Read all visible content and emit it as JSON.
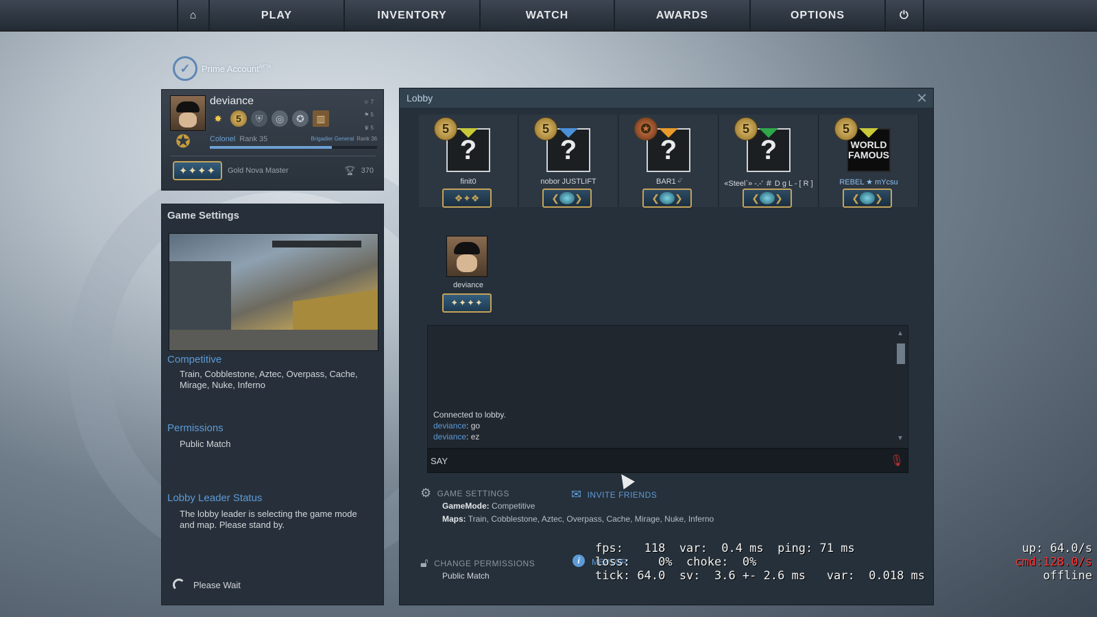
{
  "nav": {
    "items": [
      "PLAY",
      "INVENTORY",
      "WATCH",
      "AWARDS",
      "OPTIONS"
    ],
    "home_icon": "home-icon",
    "power_icon": "power-icon"
  },
  "prime": {
    "label": "Prime Account",
    "beta": "BETA"
  },
  "profile": {
    "name": "deviance",
    "stats": [
      "7",
      "5",
      "5"
    ],
    "rank_name": "Colonel",
    "rank_label": "Rank 35",
    "next_rank_name": "Brigadier General",
    "next_rank_label": "Rank 36",
    "xp_fraction": 0.73,
    "skill_group": "Gold Nova Master",
    "trophy_count": "370"
  },
  "game_settings": {
    "title": "Game Settings",
    "mode_heading": "Competitive",
    "maps": "Train, Cobblestone, Aztec, Overpass, Cache, Mirage, Nuke, Inferno",
    "permissions_heading": "Permissions",
    "permissions_value": "Public Match",
    "leader_heading": "Lobby Leader Status",
    "leader_text": "The lobby leader is selecting the game mode and map. Please stand by.",
    "wait_text": "Please Wait"
  },
  "lobby": {
    "title": "Lobby",
    "slots": [
      {
        "name": "finit0",
        "coin": "5",
        "flag_color": "#c9c93a"
      },
      {
        "name": "nobor JUSTLIFT",
        "coin": "5",
        "flag_color": "#4a90d9"
      },
      {
        "name": "BAR1 ᵕ̈",
        "coin": "",
        "flag_color": "#e89a2a"
      },
      {
        "name": "«Steel`» -.-' ＃ D g L - [ R ]",
        "coin": "5",
        "flag_color": "#2ea84a"
      },
      {
        "name": "REBEL ★ mYcsu",
        "coin": "5",
        "flag_color": "#c9c93a",
        "avatar_text": "WORLD FAMOUS"
      }
    ],
    "member": {
      "name": "deviance"
    },
    "chat": [
      {
        "who": "",
        "text": "Connected to lobby."
      },
      {
        "who": "deviance",
        "text": ": go"
      },
      {
        "who": "deviance",
        "text": ": ez"
      }
    ],
    "say_label": "SAY",
    "game_settings_label": "GAME SETTINGS",
    "invite_label": "INVITE FRIENDS",
    "gamemode_key": "GameMode:",
    "gamemode_value": "Competitive",
    "maps_key": "Maps:",
    "maps_value": "Train, Cobblestone, Aztec, Overpass, Cache, Mirage, Nuke, Inferno",
    "change_perm_label": "CHANGE PERMISSIONS",
    "perm_value": "Public Match",
    "info_label": "MENTOR"
  },
  "netgraph": {
    "line1": "fps:   118  var:  0.4 ms  ping: 71 ms",
    "line2": "loss:    0%  choke:  0%",
    "line3": "tick: 64.0  sv:  3.6 +- 2.6 ms   var:  0.018 ms",
    "up": "up: 64.0/s",
    "cmd": "cmd:128.0/s",
    "status": "offline"
  }
}
